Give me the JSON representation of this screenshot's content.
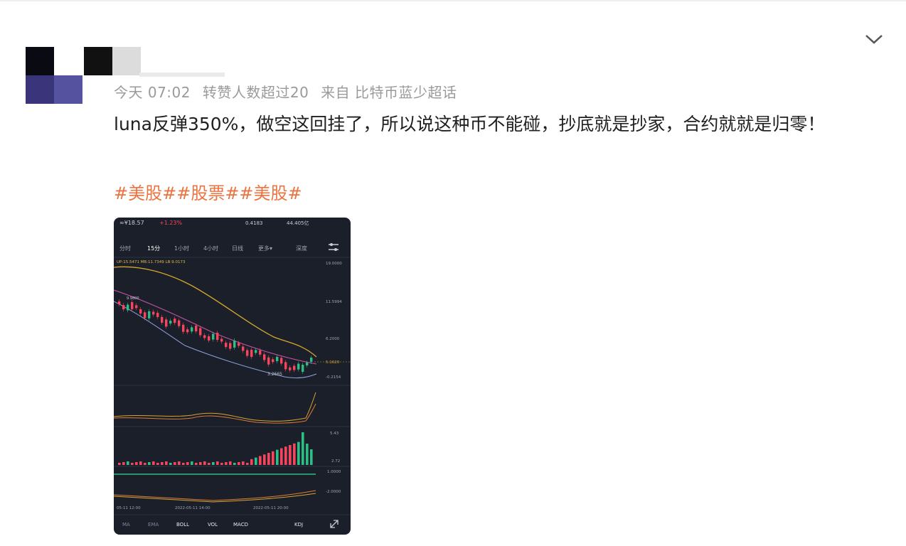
{
  "post": {
    "meta": {
      "time": "今天 07:02",
      "reposts": "转赞人数超过20",
      "source": "来自 比特币蓝少超话"
    },
    "text": "luna反弹350%，做空这回挂了，所以说这种币不能碰，抄底就是抄家，合约就就是归零！",
    "tags": "#美股##股票##美股#"
  },
  "icons": {
    "collapse": "chevron-down-icon",
    "settings": "sliders-icon",
    "expand": "expand-icon"
  },
  "chart": {
    "header": {
      "price": "≈¥18.57",
      "change": "+1.23%",
      "vol": "0.4183",
      "amount": "44.405亿"
    },
    "tabs": [
      "分时",
      "15分",
      "1小时",
      "4小时",
      "日线",
      "更多▾",
      "深度"
    ],
    "indicators_bottom": [
      "MA",
      "EMA",
      "BOLL",
      "VOL",
      "MACD",
      "KDJ"
    ],
    "labels": {
      "boll_legend": "UP:15.5471  MB:11.7349  LB:9.0173",
      "price_axis": [
        "19.0000",
        "11.5994",
        "6.2000",
        "5.1620",
        "-0.2154"
      ],
      "low_label": "3.2665",
      "high_label": "9.9800",
      "vol_axis": [
        "5.43",
        "2.72"
      ],
      "macd_axis": [
        "1.0000",
        "-2.0000"
      ],
      "time_axis": [
        "05-11 12:00",
        "2022-05-11 14:00",
        "2022-05-11 20:00"
      ]
    }
  },
  "colors": {
    "tag": "#eb7340",
    "meta": "#9a9a9a",
    "up": "#2ebd85",
    "down": "#f6465d"
  }
}
